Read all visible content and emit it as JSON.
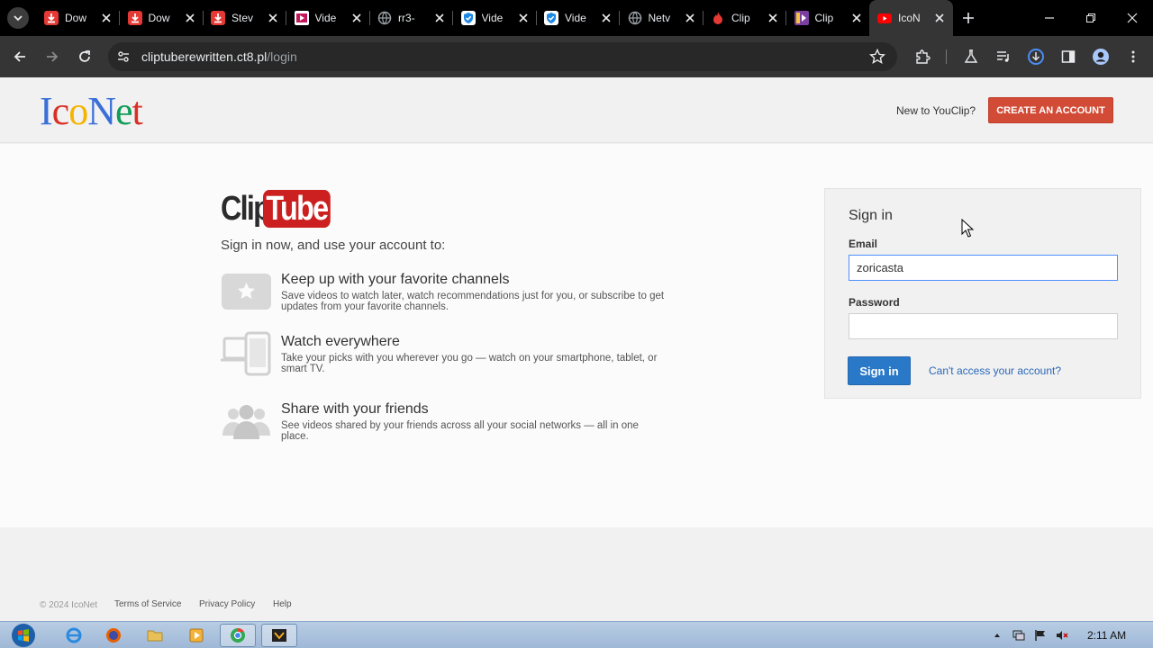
{
  "browser": {
    "tabs": [
      {
        "title": "Dow",
        "icon": "download-icon",
        "color": "#e53935"
      },
      {
        "title": "Dow",
        "icon": "download-icon",
        "color": "#e53935"
      },
      {
        "title": "Stev",
        "icon": "download-icon",
        "color": "#e53935"
      },
      {
        "title": "Vide",
        "icon": "video-icon",
        "color": "#c2185b"
      },
      {
        "title": "rr3-",
        "icon": "globe-icon",
        "color": "#9aa0a6"
      },
      {
        "title": "Vide",
        "icon": "shield-check-icon",
        "color": "#1e88e5"
      },
      {
        "title": "Vide",
        "icon": "shield-check-icon",
        "color": "#1e88e5"
      },
      {
        "title": "Netv",
        "icon": "globe-icon",
        "color": "#9aa0a6"
      },
      {
        "title": "Clip",
        "icon": "flame-icon",
        "color": "#e53935"
      },
      {
        "title": "Clip",
        "icon": "clip-icon",
        "color": "#7b3fa0"
      },
      {
        "title": "IcoN",
        "icon": "youtube-icon",
        "color": "#ff0000",
        "active": true
      }
    ],
    "address": {
      "host": "cliptuberewritten.ct8.pl",
      "path": "/login"
    }
  },
  "header": {
    "logo_letters": [
      {
        "ch": "I",
        "color": "#3a6fd8"
      },
      {
        "ch": "c",
        "color": "#d93025"
      },
      {
        "ch": "o",
        "color": "#f4b400"
      },
      {
        "ch": "N",
        "color": "#3a6fd8"
      },
      {
        "ch": "e",
        "color": "#0f9d58"
      },
      {
        "ch": "t",
        "color": "#d93025"
      }
    ],
    "new_to": "New to YouClip?",
    "create_account": "CREATE AN ACCOUNT"
  },
  "main": {
    "brand_clip": "Clip",
    "brand_tube": "Tube",
    "lead": "Sign in now, and use your account to:",
    "features": [
      {
        "icon": "star-icon",
        "title": "Keep up with your favorite channels",
        "desc": "Save videos to watch later, watch recommendations just for you, or subscribe to get updates from your favorite channels."
      },
      {
        "icon": "devices-icon",
        "title": "Watch everywhere",
        "desc": "Take your picks with you wherever you go — watch on your smartphone, tablet, or smart TV."
      },
      {
        "icon": "people-icon",
        "title": "Share with your friends",
        "desc": "See videos shared by your friends across all your social networks — all in one place."
      }
    ]
  },
  "signin": {
    "title": "Sign in",
    "email_label": "Email",
    "email_value": "zoricasta",
    "password_label": "Password",
    "password_value": "",
    "button": "Sign in",
    "cant_access": "Can't access your account?"
  },
  "footer": {
    "copyright": "© 2024 IcoNet",
    "links": [
      "Terms of Service",
      "Privacy Policy",
      "Help"
    ]
  },
  "taskbar": {
    "clock": "2:11 AM"
  }
}
